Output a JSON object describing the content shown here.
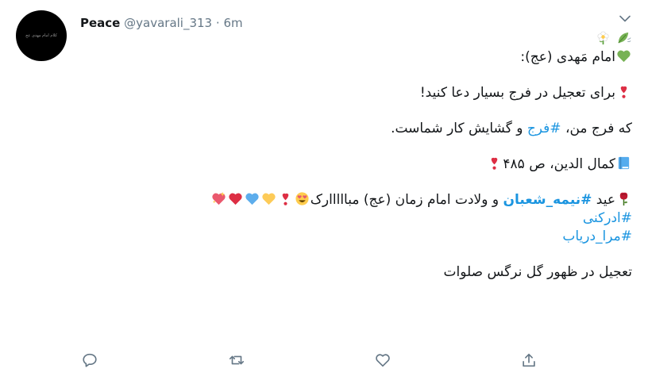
{
  "tweet": {
    "avatar_text": "کلام امام مهدی عج",
    "author_name": "Peace",
    "author_handle": "@yavarali_313",
    "separator": "·",
    "timestamp": "6m",
    "lines": {
      "l2": "امام مَهدی (عج):",
      "l3": "برای تعجیل در فرج بسیار دعا کنید!",
      "l4_pre": "که فرج من، ",
      "l4_tag": "#فرج",
      "l4_post": " و گشایش کار شماست.",
      "l5": "کمال الدین، ص ۴۸۵",
      "l6_pre": "عید ",
      "l6_tag": "#نیمه_شعبان",
      "l6_post": " و ولادت امام زمان (عج) مبااااارک",
      "l7_tag": "#ادرکنی",
      "l8_tag": "#مرا_دریاب",
      "l9": "تعجیل در ظهور گل نرگس صلوات"
    }
  },
  "icons": {
    "caret": "chevron-down-icon",
    "reply": "reply-icon",
    "retweet": "retweet-icon",
    "like": "heart-icon",
    "share": "share-icon"
  },
  "colors": {
    "hashtag": "#1b95e0",
    "meta": "#657786",
    "icon": "#657786"
  }
}
